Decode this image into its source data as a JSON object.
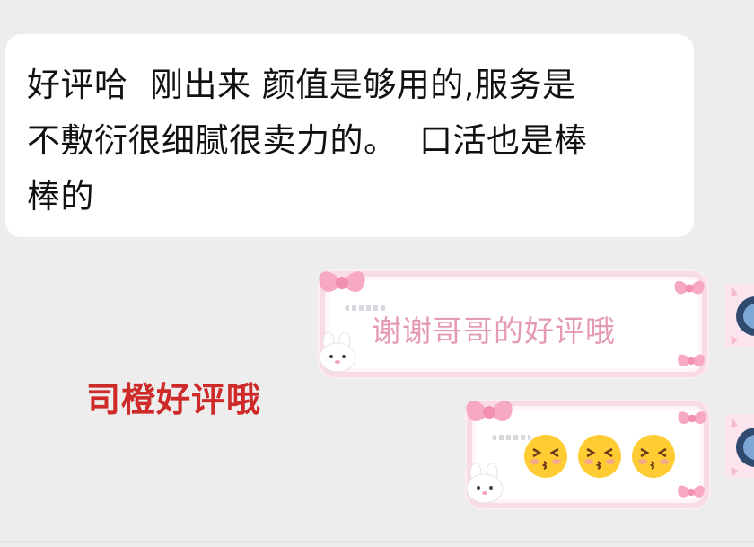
{
  "messages": {
    "incoming_text": "好评哈  刚出来 颜值是够用的,服务是\n不敷衍很细腻很卖力的。  口活也是棒\n棒的",
    "overlay_text": "司橙好评哦",
    "reply_sticker_text": "谢谢哥哥的好评哦",
    "reply_emojis": [
      "kissing-face-emoji",
      "kissing-face-emoji",
      "kissing-face-emoji"
    ]
  },
  "colors": {
    "background": "#ededed",
    "bubble": "#ffffff",
    "overlay_red": "#cf2a2a",
    "sticker_pink": "#e59ab3",
    "frame_pink": "#f8dbe6"
  }
}
